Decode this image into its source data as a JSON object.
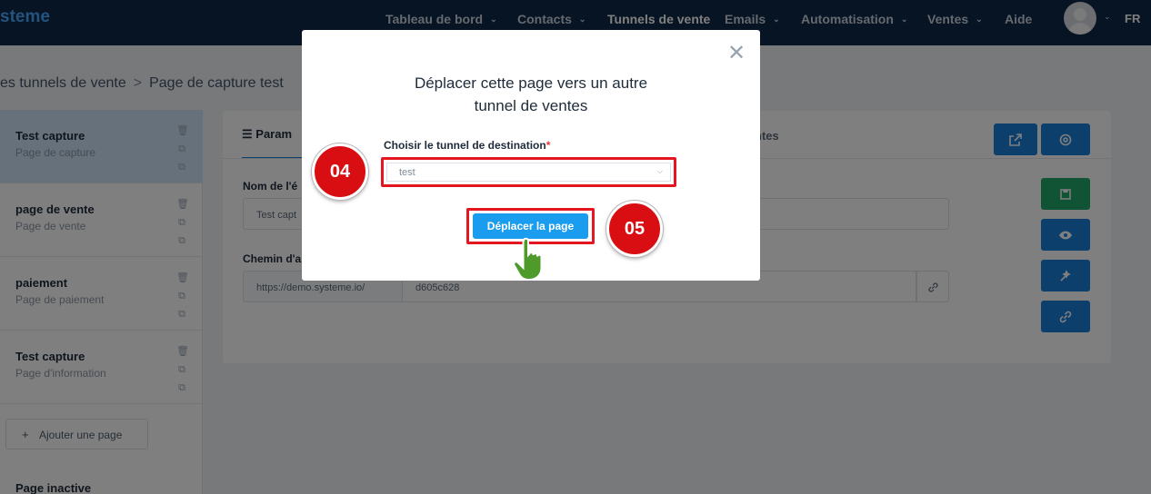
{
  "brand": {
    "logo_text": "steme"
  },
  "nav": {
    "items": [
      {
        "label": "Tableau de bord",
        "dropdown": true
      },
      {
        "label": "Contacts",
        "dropdown": true
      },
      {
        "label": "Tunnels de vente",
        "dropdown": false,
        "active": true
      },
      {
        "label": "Emails",
        "dropdown": true
      },
      {
        "label": "Automatisation",
        "dropdown": true
      },
      {
        "label": "Ventes",
        "dropdown": true
      },
      {
        "label": "Aide",
        "dropdown": false
      }
    ],
    "language": "FR"
  },
  "breadcrumb": {
    "parent": "es tunnels de vente",
    "separator": ">",
    "current": "Page de capture test"
  },
  "sidebar": {
    "pages": [
      {
        "name": "Test capture",
        "type": "Page de capture",
        "active": true
      },
      {
        "name": "page de vente",
        "type": "Page de vente"
      },
      {
        "name": "paiement",
        "type": "Page de paiement"
      },
      {
        "name": "Test capture",
        "type": "Page d'information"
      }
    ],
    "add_page_label": "Ajouter une page",
    "inactive_label": "Page inactive"
  },
  "main": {
    "tab_params": "Param",
    "tab_other": "ntes",
    "name_label": "Nom de l'é",
    "name_value": "Test capt",
    "path_label": "Chemin d'a",
    "path_prefix": "https://demo.systeme.io/",
    "path_value": "d605c628"
  },
  "modal": {
    "title_line1": "Déplacer cette page vers un autre",
    "title_line2": "tunnel de ventes",
    "field_label": "Choisir le tunnel de destination",
    "required_mark": "*",
    "select_value": "test",
    "button_label": "Déplacer la page",
    "close_symbol": "✕"
  },
  "steps": [
    {
      "label": "04"
    },
    {
      "label": "05"
    }
  ],
  "colors": {
    "nav_bg": "#0f2846",
    "primary": "#1a7ed9",
    "button_blue": "#1a9dee",
    "success": "#21a76a",
    "highlight_red": "#e4161f",
    "step_red": "#d90e13"
  }
}
